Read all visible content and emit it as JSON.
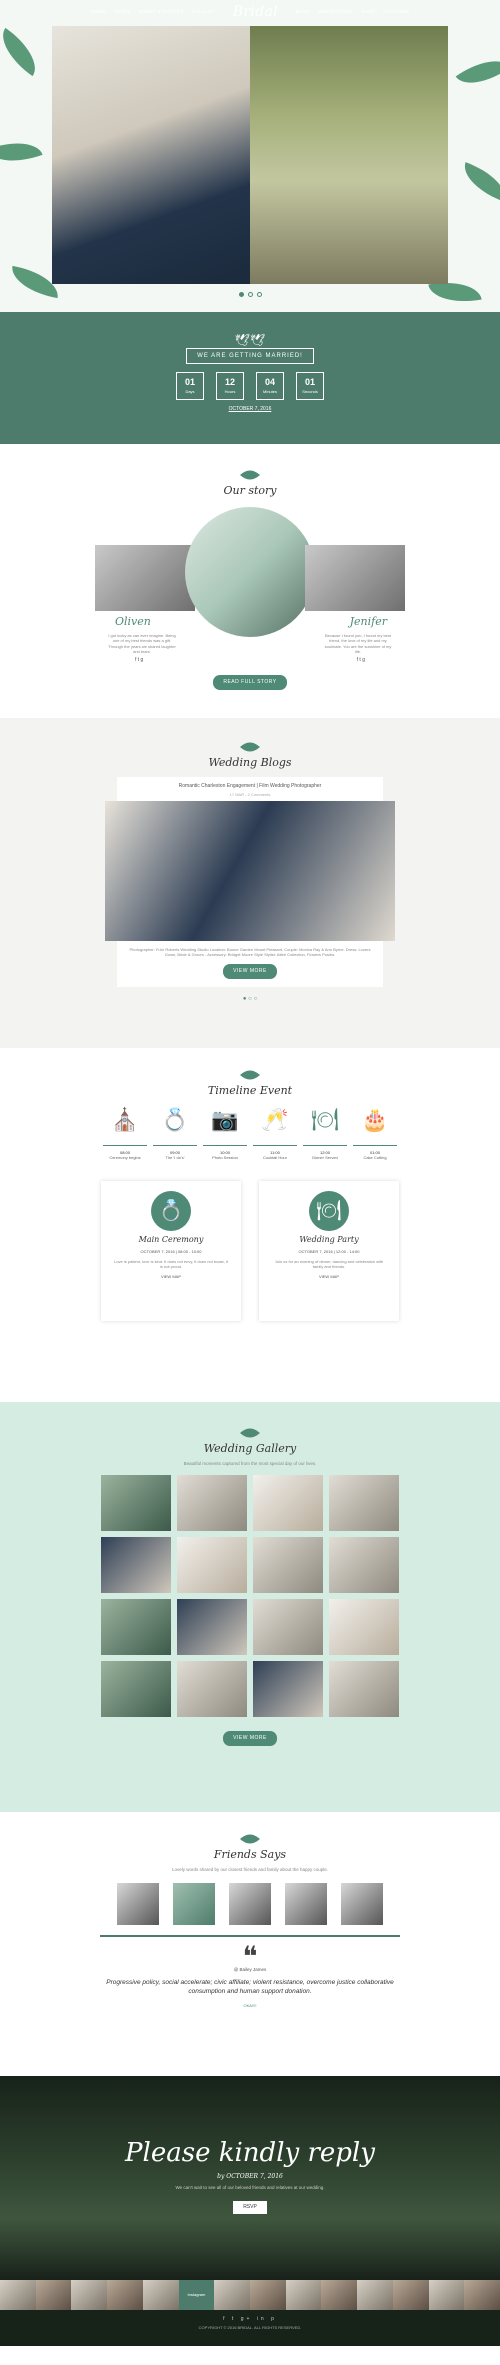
{
  "nav": {
    "items": [
      "HOME",
      "PAGES",
      "EVENT & PARTIES",
      "GALLERY",
      "BLOG",
      "SHORTCODES",
      "SHOP",
      "LOCATION"
    ],
    "logo": "Bridal"
  },
  "countdown": {
    "title": "WE ARE GETTING MARRIED!",
    "boxes": [
      {
        "v": "01",
        "l": "Days"
      },
      {
        "v": "12",
        "l": "Hours"
      },
      {
        "v": "04",
        "l": "Minutes"
      },
      {
        "v": "01",
        "l": "Seconds"
      }
    ],
    "date": "OCTOBER 7, 2016"
  },
  "story": {
    "title": "Our story",
    "left_name": "Oliven",
    "right_name": "Jenifer",
    "left_bio": "I got lucky as can ever imagine. Being one of my best friends was a gift. Through the years we shared laughter and tears.",
    "right_bio": "Because I found you, I found my best friend, the love of my life and my soulmate. You are the sunshine of my life.",
    "button": "READ FULL STORY"
  },
  "blog": {
    "title": "Wedding Blogs",
    "post_title": "Romantic Charleston Engagement | Film Wedding Photographer",
    "meta": "17 MAR  -  2 Comments",
    "excerpt": "Photographer: Fuhr Roberts Wedding Studio Location: Boone Garden Mount Pleasant, Couple: Monica Ray & Ann Byrne. Dress: Lovers Gown, Bride & Groom - Accessory: Bridget Moore Style Stylist: Attire Collection, Flowers Posies.",
    "button": "VIEW MORE"
  },
  "timeline": {
    "title": "Timeline Event",
    "items": [
      {
        "icon": "⛪",
        "time": "08:00",
        "name": "Ceremony begins"
      },
      {
        "icon": "💍",
        "time": "09:00",
        "name": "The 'I do's'"
      },
      {
        "icon": "📷",
        "time": "10:00",
        "name": "Photo Session"
      },
      {
        "icon": "🥂",
        "time": "11:00",
        "name": "Cocktail Hour"
      },
      {
        "icon": "🍽",
        "time": "12:00",
        "name": "Dinner Served"
      },
      {
        "icon": "🎂",
        "time": "01:00",
        "name": "Cake Cutting"
      }
    ],
    "events": [
      {
        "icon": "💍",
        "title": "Main Ceremony",
        "date": "OCTOBER 7, 2016 | 08:00 - 10:00",
        "body": "Love is patient, love is kind. It does not envy, it does not boast, it is not proud.",
        "link": "VIEW MAP"
      },
      {
        "icon": "🍽",
        "title": "Wedding Party",
        "date": "OCTOBER 7, 2016 | 12:00 - 14:00",
        "body": "Join us for an evening of dinner, dancing and celebration with family and friends.",
        "link": "VIEW MAP"
      }
    ]
  },
  "gallery": {
    "title": "Wedding Gallery",
    "sub": "Beautiful moments captured from the most special day of our lives.",
    "button": "VIEW MORE"
  },
  "friends": {
    "title": "Friends Says",
    "sub": "Lovely words shared by our closest friends and family about the happy couple.",
    "name": "@ Bailey James",
    "quote": "Progressive policy, social accelerate; civic affiliate; violent resistance, overcome justice collaborative consumption and human support donation.",
    "contact": "OKAY!!"
  },
  "rsvp": {
    "title": "Please kindly reply",
    "by": "by OCTOBER 7, 2016",
    "body": "We can't wait to see all of our beloved friends and relatives at our wedding.",
    "button": "RSVP"
  },
  "insta": {
    "label": "Instagram"
  },
  "footer": {
    "social": "f  t  g+  in  p",
    "copy": "COPYRIGHT © 2016 BRIDAL. ALL RIGHTS RESERVED."
  }
}
